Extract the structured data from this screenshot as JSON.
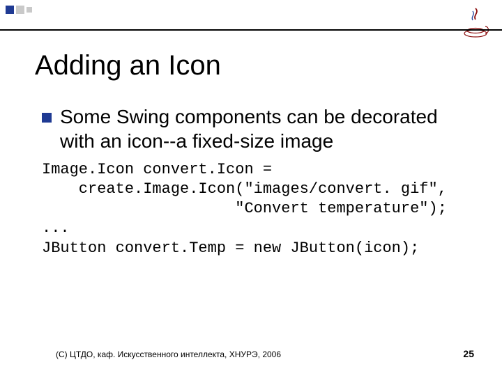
{
  "title": "Adding an Icon",
  "bullet": "Some Swing components can be decorated with an icon--a fixed-size image",
  "code": "Image.Icon convert.Icon =\n    create.Image.Icon(\"images/convert. gif\",\n                     \"Convert temperature\");\n...\nJButton convert.Temp = new JButton(icon);",
  "footer": {
    "copyright": "(С) ЦТДО, каф. Искусственного интеллекта, ХНУРЭ, 2006",
    "page": "25"
  }
}
